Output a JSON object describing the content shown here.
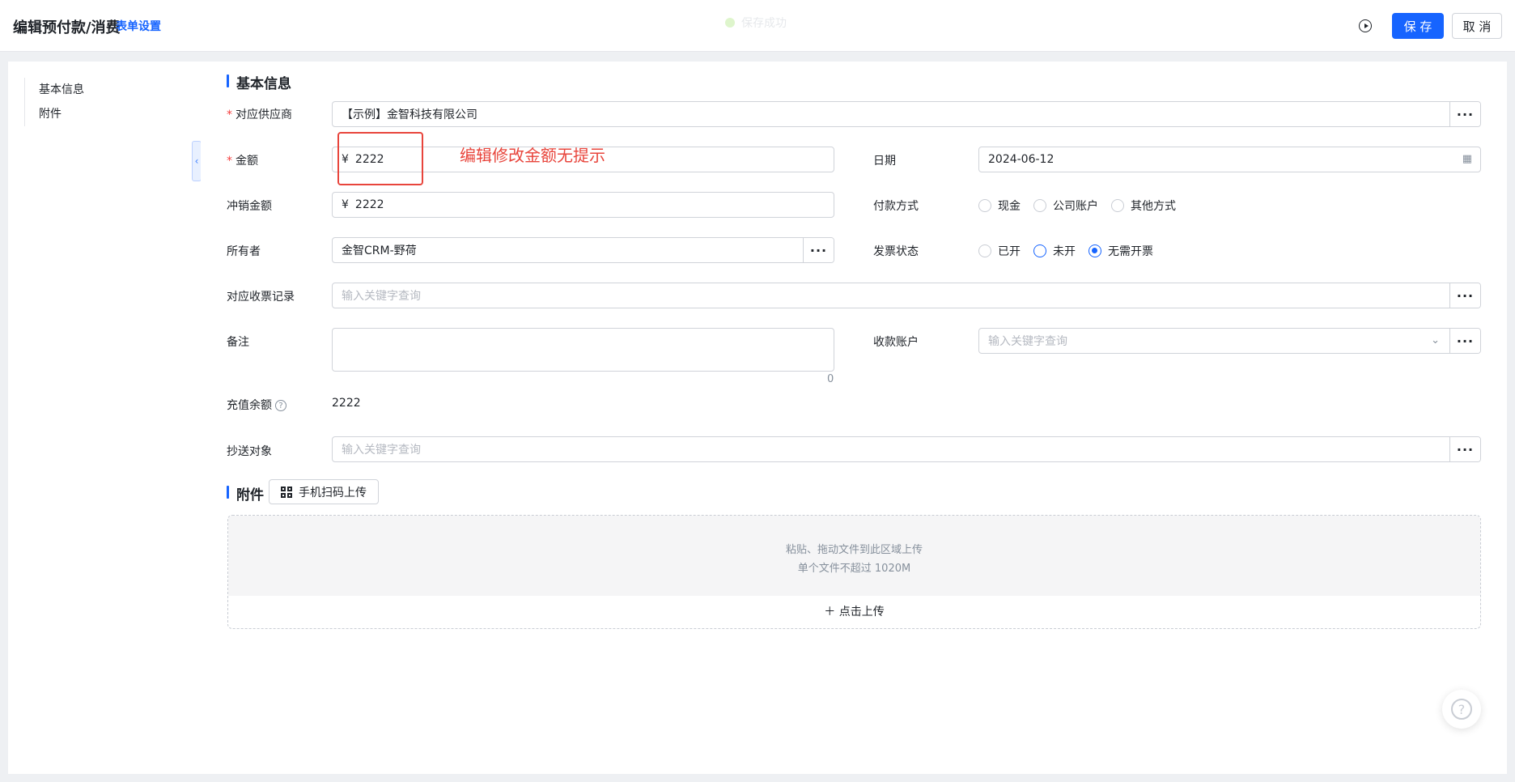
{
  "header": {
    "title": "编辑预付款/消费",
    "form_settings": "表单设置",
    "save_status": "保存成功",
    "save_label": "保 存",
    "cancel_label": "取 消"
  },
  "sidebar": {
    "items": [
      {
        "label": "基本信息"
      },
      {
        "label": "附件"
      }
    ]
  },
  "sections": {
    "basic": "基本信息",
    "attachment": "附件"
  },
  "fields": {
    "supplier": {
      "label": "对应供应商",
      "value": "【示例】金智科技有限公司"
    },
    "amount": {
      "label": "金额",
      "currency": "¥",
      "value": "2222"
    },
    "date": {
      "label": "日期",
      "value": "2024-06-12"
    },
    "writeoff": {
      "label": "冲销金额",
      "currency": "¥",
      "value": "2222"
    },
    "payment_method": {
      "label": "付款方式",
      "options": [
        "现金",
        "公司账户",
        "其他方式"
      ],
      "selected": null
    },
    "owner": {
      "label": "所有者",
      "value": "金智CRM-野荷"
    },
    "invoice_status": {
      "label": "发票状态",
      "options": [
        "已开",
        "未开",
        "无需开票"
      ],
      "selected": "无需开票"
    },
    "receipt_record": {
      "label": "对应收票记录",
      "placeholder": "输入关键字查询"
    },
    "remark": {
      "label": "备注",
      "counter": "0"
    },
    "receiving_account": {
      "label": "收款账户",
      "placeholder": "输入关键字查询"
    },
    "recharge_balance": {
      "label": "充值余额",
      "value": "2222"
    },
    "cc": {
      "label": "抄送对象",
      "placeholder": "输入关键字查询"
    }
  },
  "attachment": {
    "qr_upload": "手机扫码上传",
    "drop_hint": "粘贴、拖动文件到此区域上传",
    "size_hint": "单个文件不超过 1020M",
    "upload_button": "点击上传"
  },
  "annotation": {
    "text": "编辑修改金额无提示",
    "color": "#e8453c"
  },
  "colors": {
    "accent": "#1664ff",
    "required": "#f53f3f"
  }
}
